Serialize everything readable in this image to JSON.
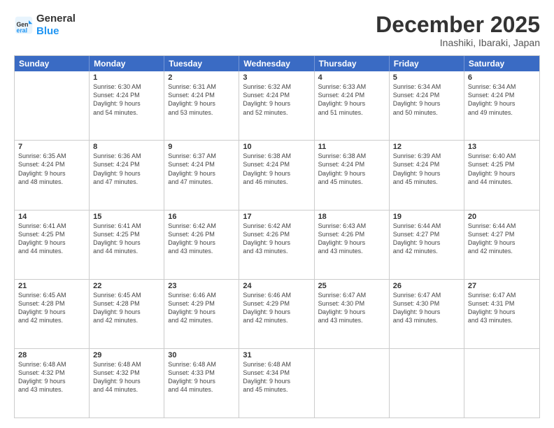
{
  "logo": {
    "line1": "General",
    "line2": "Blue"
  },
  "title": "December 2025",
  "subtitle": "Inashiki, Ibaraki, Japan",
  "headers": [
    "Sunday",
    "Monday",
    "Tuesday",
    "Wednesday",
    "Thursday",
    "Friday",
    "Saturday"
  ],
  "rows": [
    [
      {
        "date": "",
        "info": ""
      },
      {
        "date": "1",
        "info": "Sunrise: 6:30 AM\nSunset: 4:24 PM\nDaylight: 9 hours\nand 54 minutes."
      },
      {
        "date": "2",
        "info": "Sunrise: 6:31 AM\nSunset: 4:24 PM\nDaylight: 9 hours\nand 53 minutes."
      },
      {
        "date": "3",
        "info": "Sunrise: 6:32 AM\nSunset: 4:24 PM\nDaylight: 9 hours\nand 52 minutes."
      },
      {
        "date": "4",
        "info": "Sunrise: 6:33 AM\nSunset: 4:24 PM\nDaylight: 9 hours\nand 51 minutes."
      },
      {
        "date": "5",
        "info": "Sunrise: 6:34 AM\nSunset: 4:24 PM\nDaylight: 9 hours\nand 50 minutes."
      },
      {
        "date": "6",
        "info": "Sunrise: 6:34 AM\nSunset: 4:24 PM\nDaylight: 9 hours\nand 49 minutes."
      }
    ],
    [
      {
        "date": "7",
        "info": "Sunrise: 6:35 AM\nSunset: 4:24 PM\nDaylight: 9 hours\nand 48 minutes."
      },
      {
        "date": "8",
        "info": "Sunrise: 6:36 AM\nSunset: 4:24 PM\nDaylight: 9 hours\nand 47 minutes."
      },
      {
        "date": "9",
        "info": "Sunrise: 6:37 AM\nSunset: 4:24 PM\nDaylight: 9 hours\nand 47 minutes."
      },
      {
        "date": "10",
        "info": "Sunrise: 6:38 AM\nSunset: 4:24 PM\nDaylight: 9 hours\nand 46 minutes."
      },
      {
        "date": "11",
        "info": "Sunrise: 6:38 AM\nSunset: 4:24 PM\nDaylight: 9 hours\nand 45 minutes."
      },
      {
        "date": "12",
        "info": "Sunrise: 6:39 AM\nSunset: 4:24 PM\nDaylight: 9 hours\nand 45 minutes."
      },
      {
        "date": "13",
        "info": "Sunrise: 6:40 AM\nSunset: 4:25 PM\nDaylight: 9 hours\nand 44 minutes."
      }
    ],
    [
      {
        "date": "14",
        "info": "Sunrise: 6:41 AM\nSunset: 4:25 PM\nDaylight: 9 hours\nand 44 minutes."
      },
      {
        "date": "15",
        "info": "Sunrise: 6:41 AM\nSunset: 4:25 PM\nDaylight: 9 hours\nand 44 minutes."
      },
      {
        "date": "16",
        "info": "Sunrise: 6:42 AM\nSunset: 4:26 PM\nDaylight: 9 hours\nand 43 minutes."
      },
      {
        "date": "17",
        "info": "Sunrise: 6:42 AM\nSunset: 4:26 PM\nDaylight: 9 hours\nand 43 minutes."
      },
      {
        "date": "18",
        "info": "Sunrise: 6:43 AM\nSunset: 4:26 PM\nDaylight: 9 hours\nand 43 minutes."
      },
      {
        "date": "19",
        "info": "Sunrise: 6:44 AM\nSunset: 4:27 PM\nDaylight: 9 hours\nand 42 minutes."
      },
      {
        "date": "20",
        "info": "Sunrise: 6:44 AM\nSunset: 4:27 PM\nDaylight: 9 hours\nand 42 minutes."
      }
    ],
    [
      {
        "date": "21",
        "info": "Sunrise: 6:45 AM\nSunset: 4:28 PM\nDaylight: 9 hours\nand 42 minutes."
      },
      {
        "date": "22",
        "info": "Sunrise: 6:45 AM\nSunset: 4:28 PM\nDaylight: 9 hours\nand 42 minutes."
      },
      {
        "date": "23",
        "info": "Sunrise: 6:46 AM\nSunset: 4:29 PM\nDaylight: 9 hours\nand 42 minutes."
      },
      {
        "date": "24",
        "info": "Sunrise: 6:46 AM\nSunset: 4:29 PM\nDaylight: 9 hours\nand 42 minutes."
      },
      {
        "date": "25",
        "info": "Sunrise: 6:47 AM\nSunset: 4:30 PM\nDaylight: 9 hours\nand 43 minutes."
      },
      {
        "date": "26",
        "info": "Sunrise: 6:47 AM\nSunset: 4:30 PM\nDaylight: 9 hours\nand 43 minutes."
      },
      {
        "date": "27",
        "info": "Sunrise: 6:47 AM\nSunset: 4:31 PM\nDaylight: 9 hours\nand 43 minutes."
      }
    ],
    [
      {
        "date": "28",
        "info": "Sunrise: 6:48 AM\nSunset: 4:32 PM\nDaylight: 9 hours\nand 43 minutes."
      },
      {
        "date": "29",
        "info": "Sunrise: 6:48 AM\nSunset: 4:32 PM\nDaylight: 9 hours\nand 44 minutes."
      },
      {
        "date": "30",
        "info": "Sunrise: 6:48 AM\nSunset: 4:33 PM\nDaylight: 9 hours\nand 44 minutes."
      },
      {
        "date": "31",
        "info": "Sunrise: 6:48 AM\nSunset: 4:34 PM\nDaylight: 9 hours\nand 45 minutes."
      },
      {
        "date": "",
        "info": ""
      },
      {
        "date": "",
        "info": ""
      },
      {
        "date": "",
        "info": ""
      }
    ]
  ]
}
